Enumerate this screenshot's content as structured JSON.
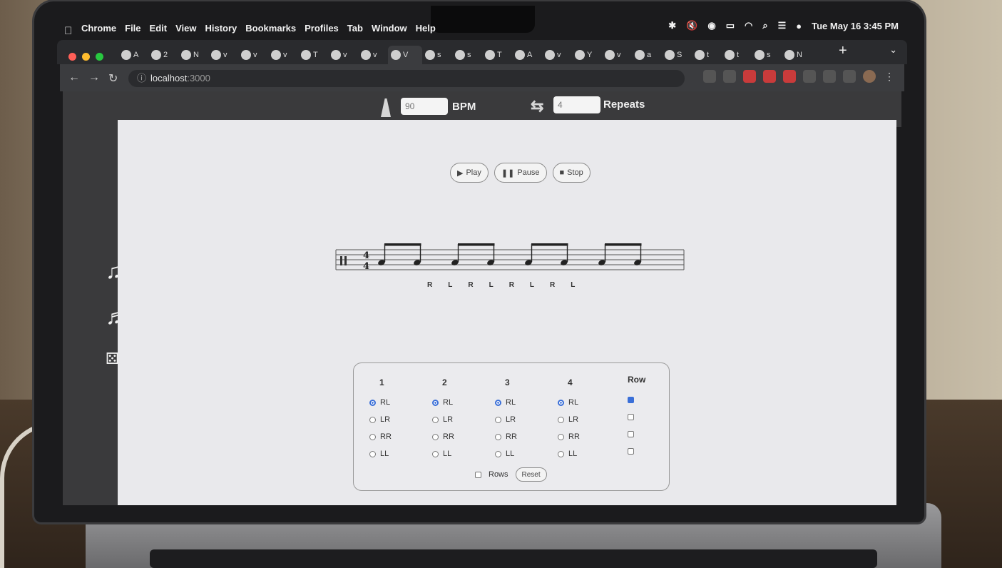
{
  "menubar": {
    "apple": "",
    "items": [
      "Chrome",
      "File",
      "Edit",
      "View",
      "History",
      "Bookmarks",
      "Profiles",
      "Tab",
      "Window",
      "Help"
    ],
    "clock": "Tue May 16  3:45 PM"
  },
  "browser": {
    "tabs": [
      "A",
      "2",
      "N",
      "v",
      "v",
      "v",
      "T",
      "v",
      "v",
      "V",
      "s",
      "s",
      "T",
      "A",
      "v",
      "Y",
      "v",
      "a",
      "S",
      "t",
      "t",
      "s",
      "N"
    ],
    "address": {
      "host": "localhost",
      "port": ":3000"
    }
  },
  "header": {
    "bpm_placeholder": "90",
    "bpm_label": "BPM",
    "repeats_placeholder": "4",
    "repeats_label": "Repeats"
  },
  "transport": {
    "play": "Play",
    "pause": "Pause",
    "stop": "Stop"
  },
  "notation": {
    "time_signature": [
      "4",
      "4"
    ],
    "sticking": [
      "R",
      "L",
      "R",
      "L",
      "R",
      "L",
      "R",
      "L"
    ]
  },
  "grid": {
    "columns": [
      {
        "head": "1",
        "selected": "RL"
      },
      {
        "head": "2",
        "selected": "RL"
      },
      {
        "head": "3",
        "selected": "RL"
      },
      {
        "head": "4",
        "selected": "RL"
      }
    ],
    "options": [
      "RL",
      "LR",
      "RR",
      "LL"
    ],
    "row_head": "Row",
    "row_checks": [
      true,
      false,
      false,
      false
    ],
    "rows_label": "Rows",
    "rows_checked": false,
    "reset": "Reset"
  },
  "colors": {
    "accent": "#3a6fd8",
    "app_dark": "#3a3a3c",
    "content_bg": "#e9e9ec"
  }
}
